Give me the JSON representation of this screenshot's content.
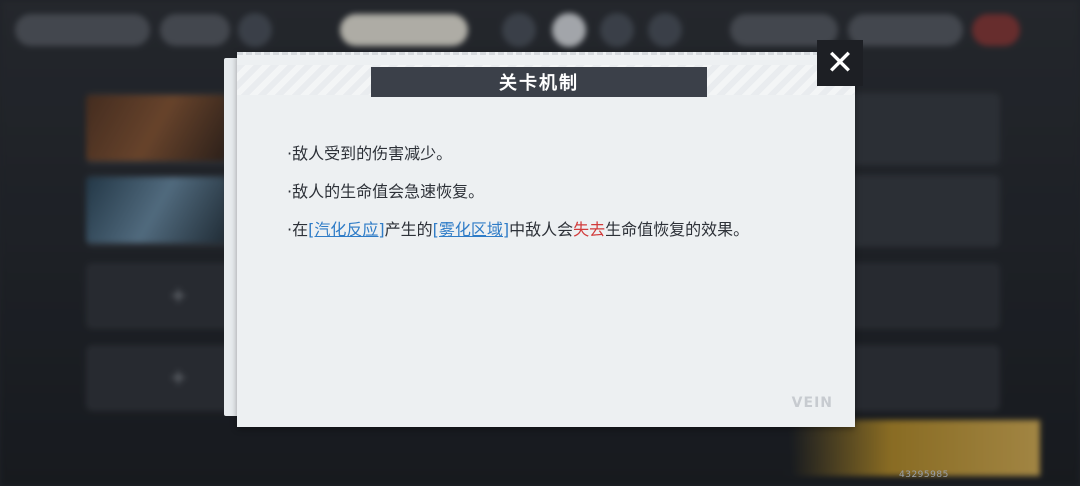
{
  "dialog": {
    "title": "关卡机制",
    "rules": {
      "r1": "·敌人受到的伤害减少。",
      "r2": "·敌人的生命值会急速恢复。",
      "r3_pre": "·在",
      "r3_kw1": "[汽化反应]",
      "r3_mid1": "产生的",
      "r3_kw2": "[雾化区域]",
      "r3_mid2": "中敌人会",
      "r3_kw3": "失去",
      "r3_post": "生命值恢复的效果。"
    },
    "watermark": "VEIN",
    "close_icon": "close-icon"
  },
  "background": {
    "id_text": "43295985"
  },
  "colors": {
    "title_bar": "#3b4049",
    "link": "#2f7cc7",
    "warning": "#d13a3a"
  }
}
